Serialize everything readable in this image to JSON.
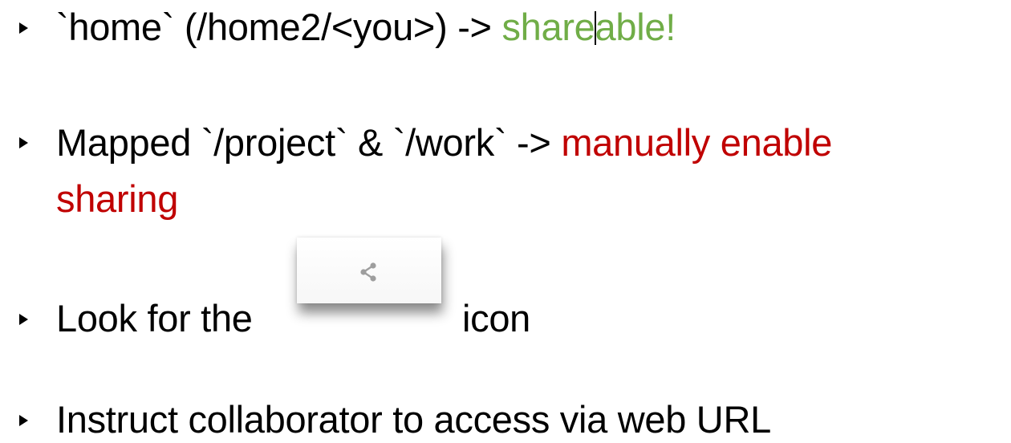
{
  "bullets": [
    {
      "text": "`home` (/home2/<you>) -> ",
      "highlight_before_cursor": "share",
      "highlight_after_cursor": "able!",
      "highlight_color": "#70ad47"
    },
    {
      "text": "Mapped `/project`  & `/work` -> ",
      "highlight_line1": "manually enable",
      "highlight_line2": "sharing",
      "highlight_color": "#c00000"
    },
    {
      "text_before_icon": "Look for the",
      "icon": "share-icon",
      "text_after_icon": "icon"
    },
    {
      "text": "Instruct collaborator to access via web URL"
    }
  ]
}
